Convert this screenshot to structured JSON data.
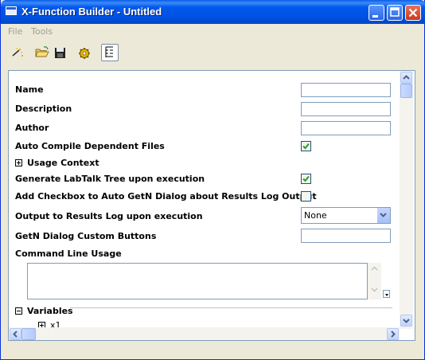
{
  "window": {
    "title": "X-Function Builder - Untitled"
  },
  "menu": {
    "file": "File",
    "tools": "Tools"
  },
  "toolbar": {
    "icons": [
      "new-wand-icon",
      "open-folder-icon",
      "save-disk-icon",
      "settings-gear-icon",
      "tree-view-icon"
    ]
  },
  "form": {
    "name_label": "Name",
    "description_label": "Description",
    "author_label": "Author",
    "auto_compile_label": "Auto Compile Dependent Files",
    "auto_compile_checked": true,
    "usage_context_label": "Usage Context",
    "labtalk_tree_label": "Generate LabTalk Tree upon execution",
    "labtalk_tree_checked": true,
    "add_checkbox_label": "Add Checkbox to Auto GetN Dialog about Results Log Output",
    "add_checkbox_checked": false,
    "output_log_label": "Output to Results Log upon execution",
    "output_log_value": "None",
    "getn_buttons_label": "GetN Dialog Custom Buttons",
    "command_line_label": "Command Line Usage",
    "variables_label": "Variables",
    "variable_first": "x1"
  },
  "colors": {
    "titlebar_accent": "#0058ee",
    "window_bg": "#ece9d8",
    "close_button": "#c83a1a"
  }
}
